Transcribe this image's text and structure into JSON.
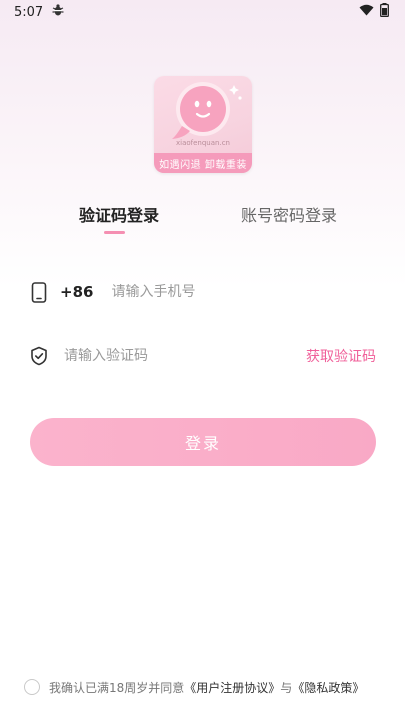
{
  "status_bar": {
    "time": "5:07"
  },
  "logo": {
    "site_text": "xiaofenquan.cn",
    "banner_text": "如遇闪退  卸载重装"
  },
  "tabs": {
    "active": "验证码登录",
    "inactive": "账号密码登录"
  },
  "phone": {
    "country_code": "+86",
    "placeholder": "请输入手机号",
    "value": ""
  },
  "verification": {
    "placeholder": "请输入验证码",
    "value": "",
    "get_code_label": "获取验证码"
  },
  "login_button": {
    "label": "登录"
  },
  "agreement": {
    "prefix": "我确认已满18周岁并同意",
    "user_agreement": "《用户注册协议》",
    "connector": "与",
    "privacy_policy": "《隐私政策》"
  },
  "colors": {
    "accent": "#f0609a",
    "button": "#f9a9c6",
    "underline": "#f58fb2"
  }
}
